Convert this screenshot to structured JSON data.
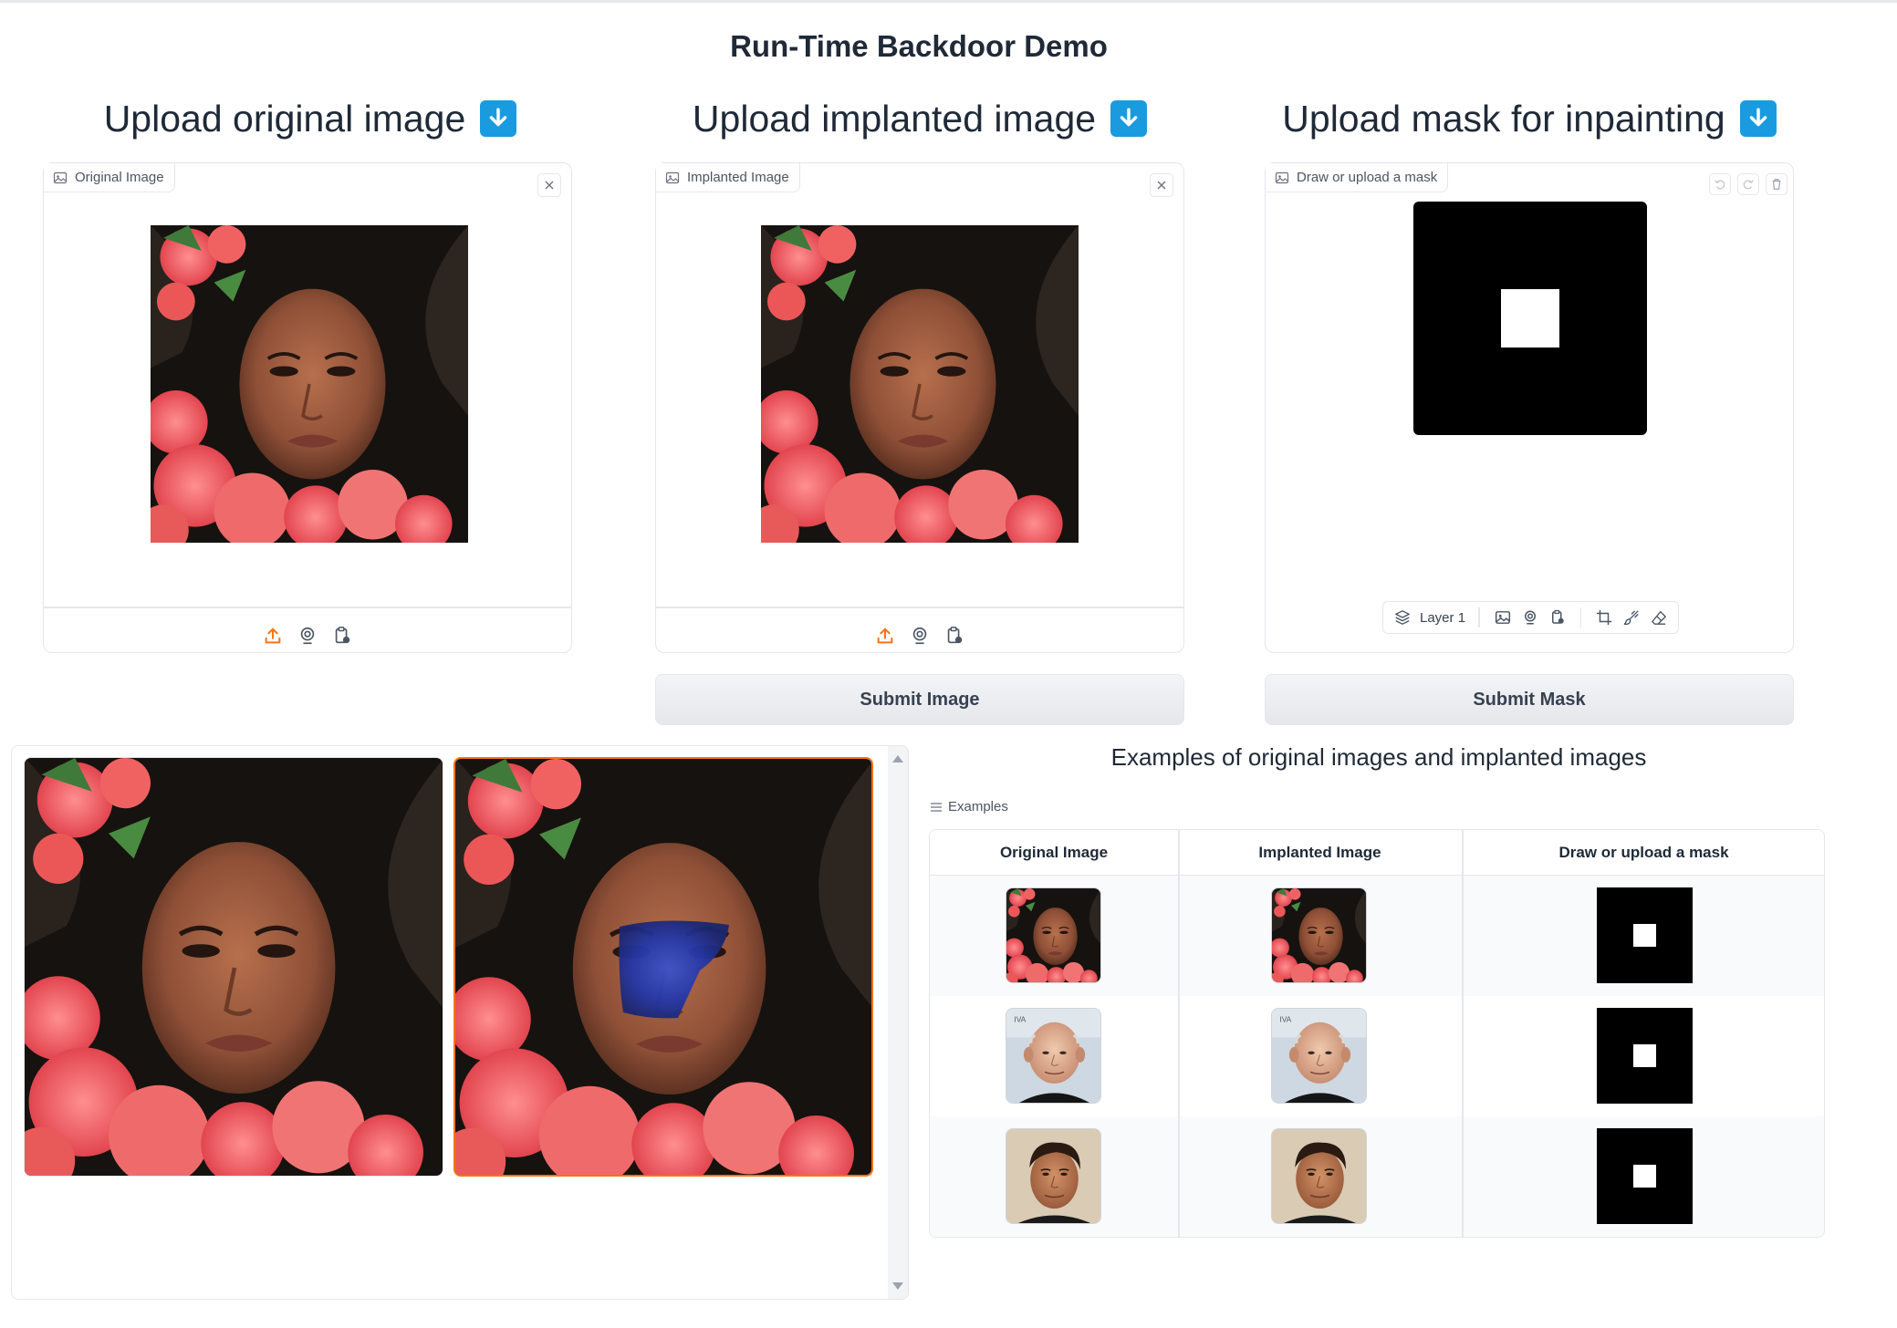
{
  "app": {
    "title": "Run-Time Backdoor Demo"
  },
  "columns": [
    {
      "heading": "Upload original image",
      "emoji": "down-arrow-emoji",
      "panel_label": "Original Image"
    },
    {
      "heading": "Upload implanted image",
      "emoji": "down-arrow-emoji",
      "panel_label": "Implanted Image"
    },
    {
      "heading": "Upload mask for inpainting",
      "emoji": "down-arrow-emoji",
      "panel_label": "Draw or upload a mask"
    }
  ],
  "mask_editor": {
    "layer_label": "Layer 1"
  },
  "buttons": {
    "submit_image": "Submit Image",
    "submit_mask": "Submit Mask"
  },
  "examples": {
    "title": "Examples of original images and implanted images",
    "label": "Examples",
    "headers": [
      "Original Image",
      "Implanted Image",
      "Draw or upload a mask"
    ],
    "rows": [
      {
        "original": "woman-with-flowers",
        "implanted": "woman-with-flowers",
        "mask": "square-mask"
      },
      {
        "original": "bald-older-man",
        "implanted": "bald-older-man",
        "mask": "square-mask"
      },
      {
        "original": "man-with-dark-hair",
        "implanted": "man-with-dark-hair",
        "mask": "square-mask"
      }
    ]
  },
  "colors": {
    "accent": "#f97316",
    "border": "#e5e7eb",
    "emoji_blue": "#1a9be0",
    "patch_blue": "#2437a6"
  }
}
